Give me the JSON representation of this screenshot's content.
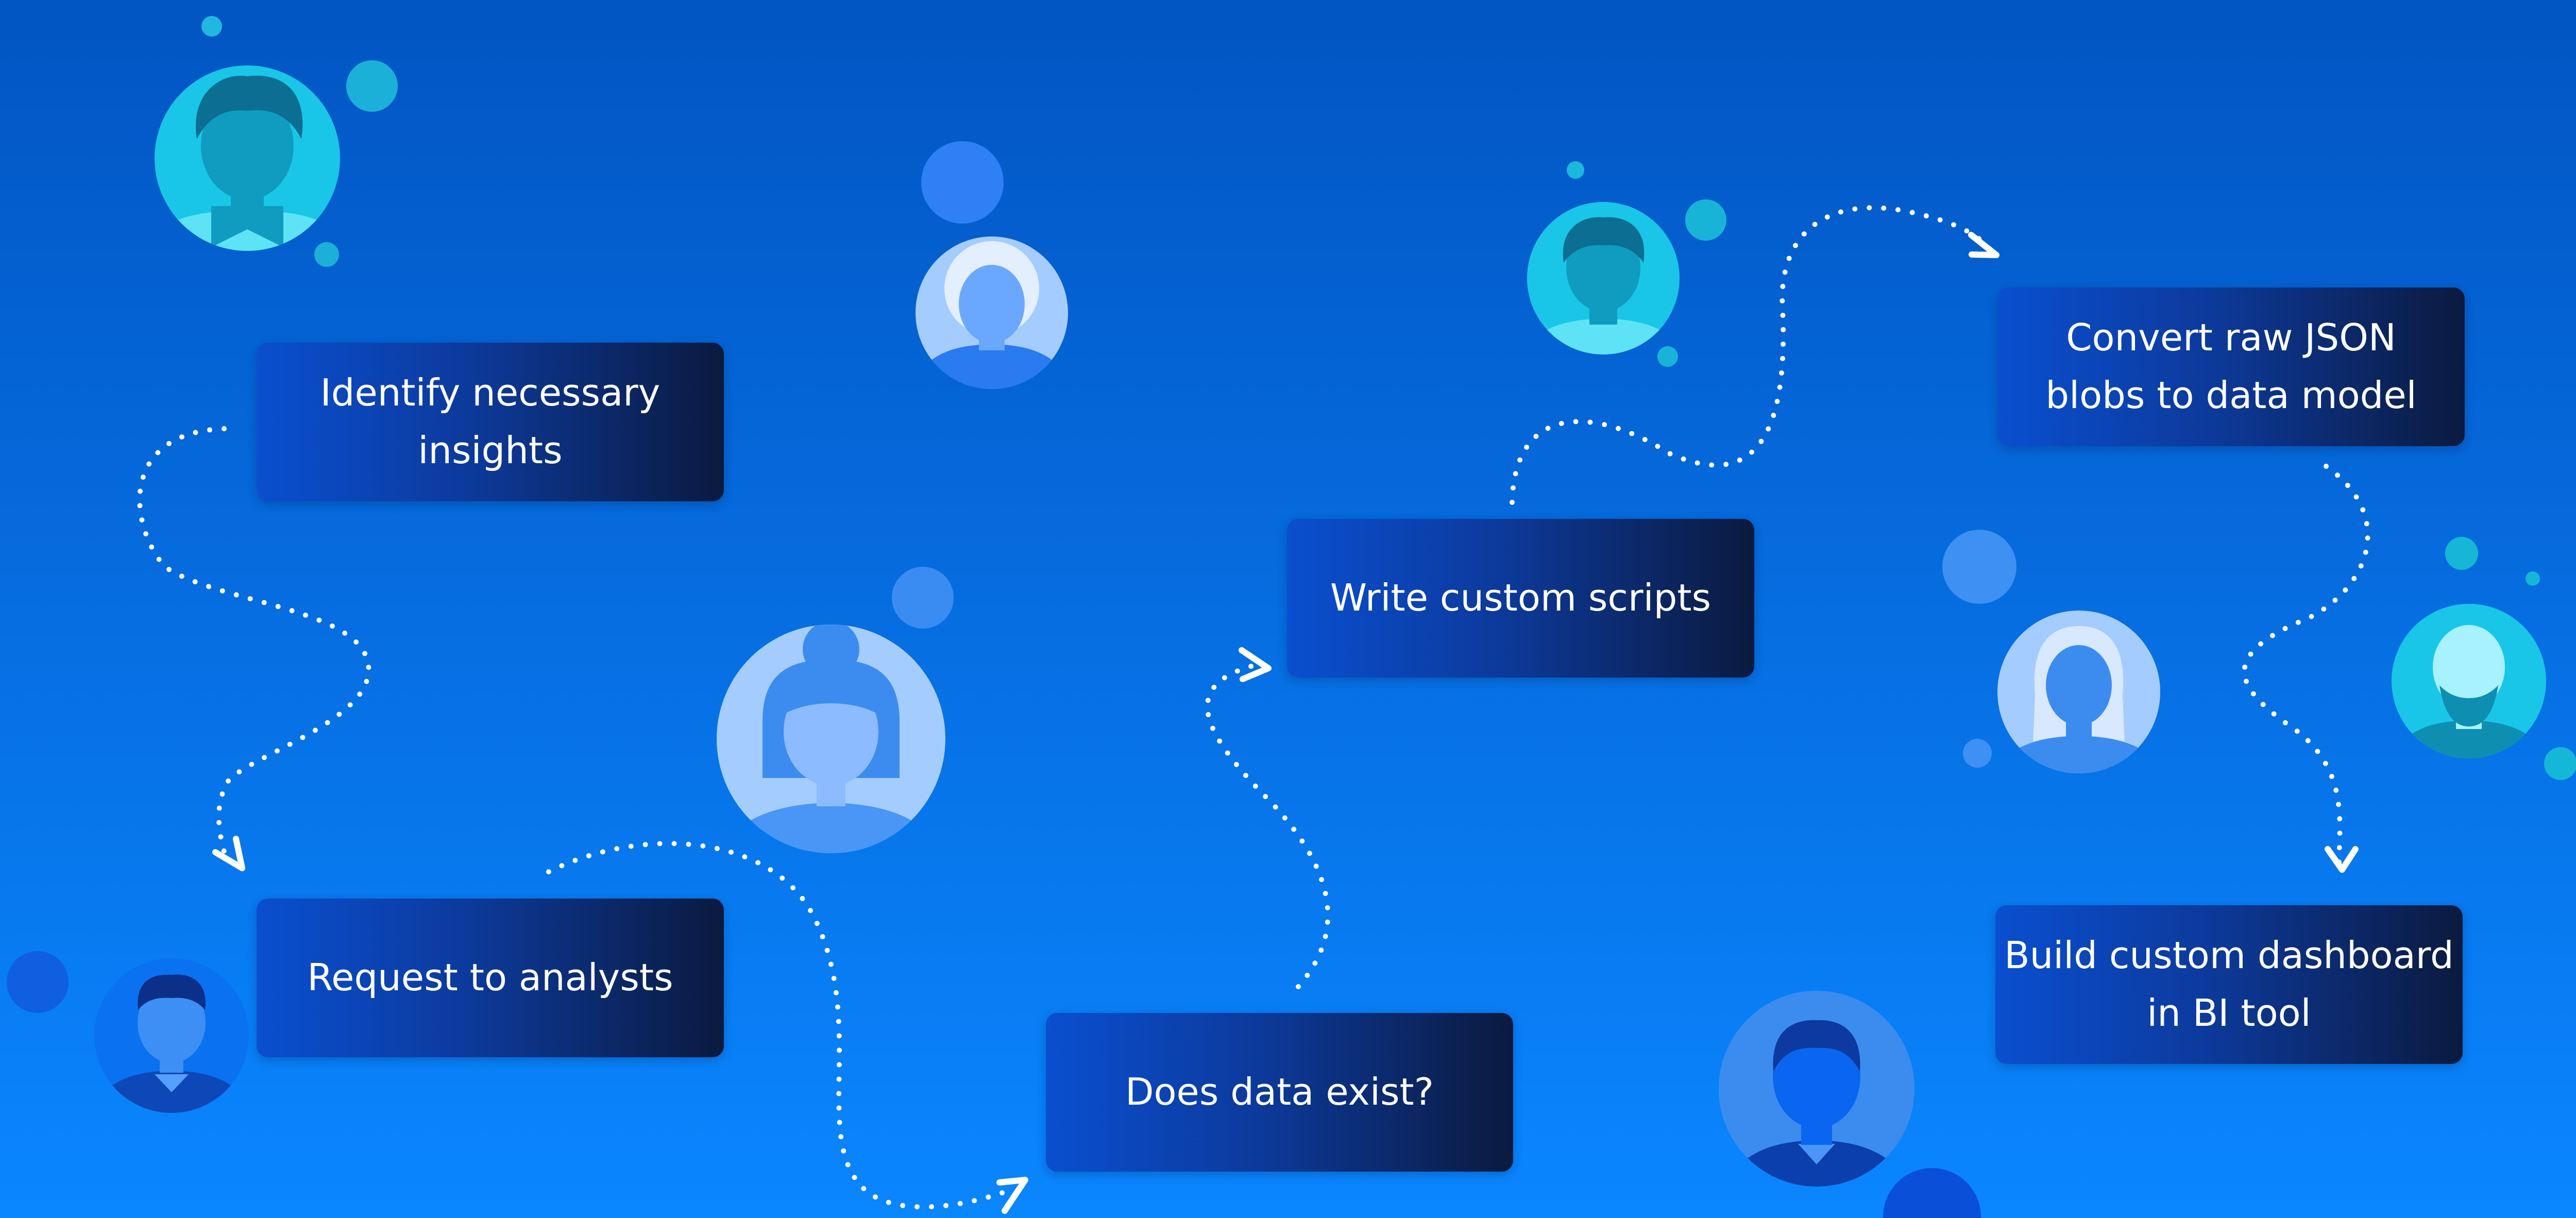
{
  "colors": {
    "bg_top": "#0255c2",
    "bg_bottom": "#0a86ff",
    "box_start": "#0a4fd0",
    "box_end": "#0b1a3f",
    "dots": "#ffffff",
    "cyan_avatar": "#19c6e8",
    "blue_avatar": "#3c8cf0",
    "pale_avatar": "#a5ccff"
  },
  "steps": [
    {
      "id": "identify",
      "label": "Identify necessary\ninsights"
    },
    {
      "id": "request",
      "label": "Request to analysts"
    },
    {
      "id": "exists",
      "label": "Does data exist?"
    },
    {
      "id": "scripts",
      "label": "Write custom scripts"
    },
    {
      "id": "convert",
      "label": "Convert raw JSON\nblobs to data model"
    },
    {
      "id": "dashboard",
      "label": "Build custom dashboard\nin BI tool"
    }
  ],
  "avatars": [
    {
      "id": "top-left",
      "style": "cyan",
      "hair": "curly"
    },
    {
      "id": "top-center",
      "style": "pale",
      "hair": "afro"
    },
    {
      "id": "middle-woman",
      "style": "pale",
      "hair": "bun"
    },
    {
      "id": "bottom-left",
      "style": "blue",
      "hair": "short"
    },
    {
      "id": "top-right",
      "style": "cyan",
      "hair": "curly"
    },
    {
      "id": "right-woman",
      "style": "pale",
      "hair": "long"
    },
    {
      "id": "right-bearded",
      "style": "cyan",
      "hair": "bald-beard"
    },
    {
      "id": "bottom-center",
      "style": "blue",
      "hair": "short"
    }
  ]
}
